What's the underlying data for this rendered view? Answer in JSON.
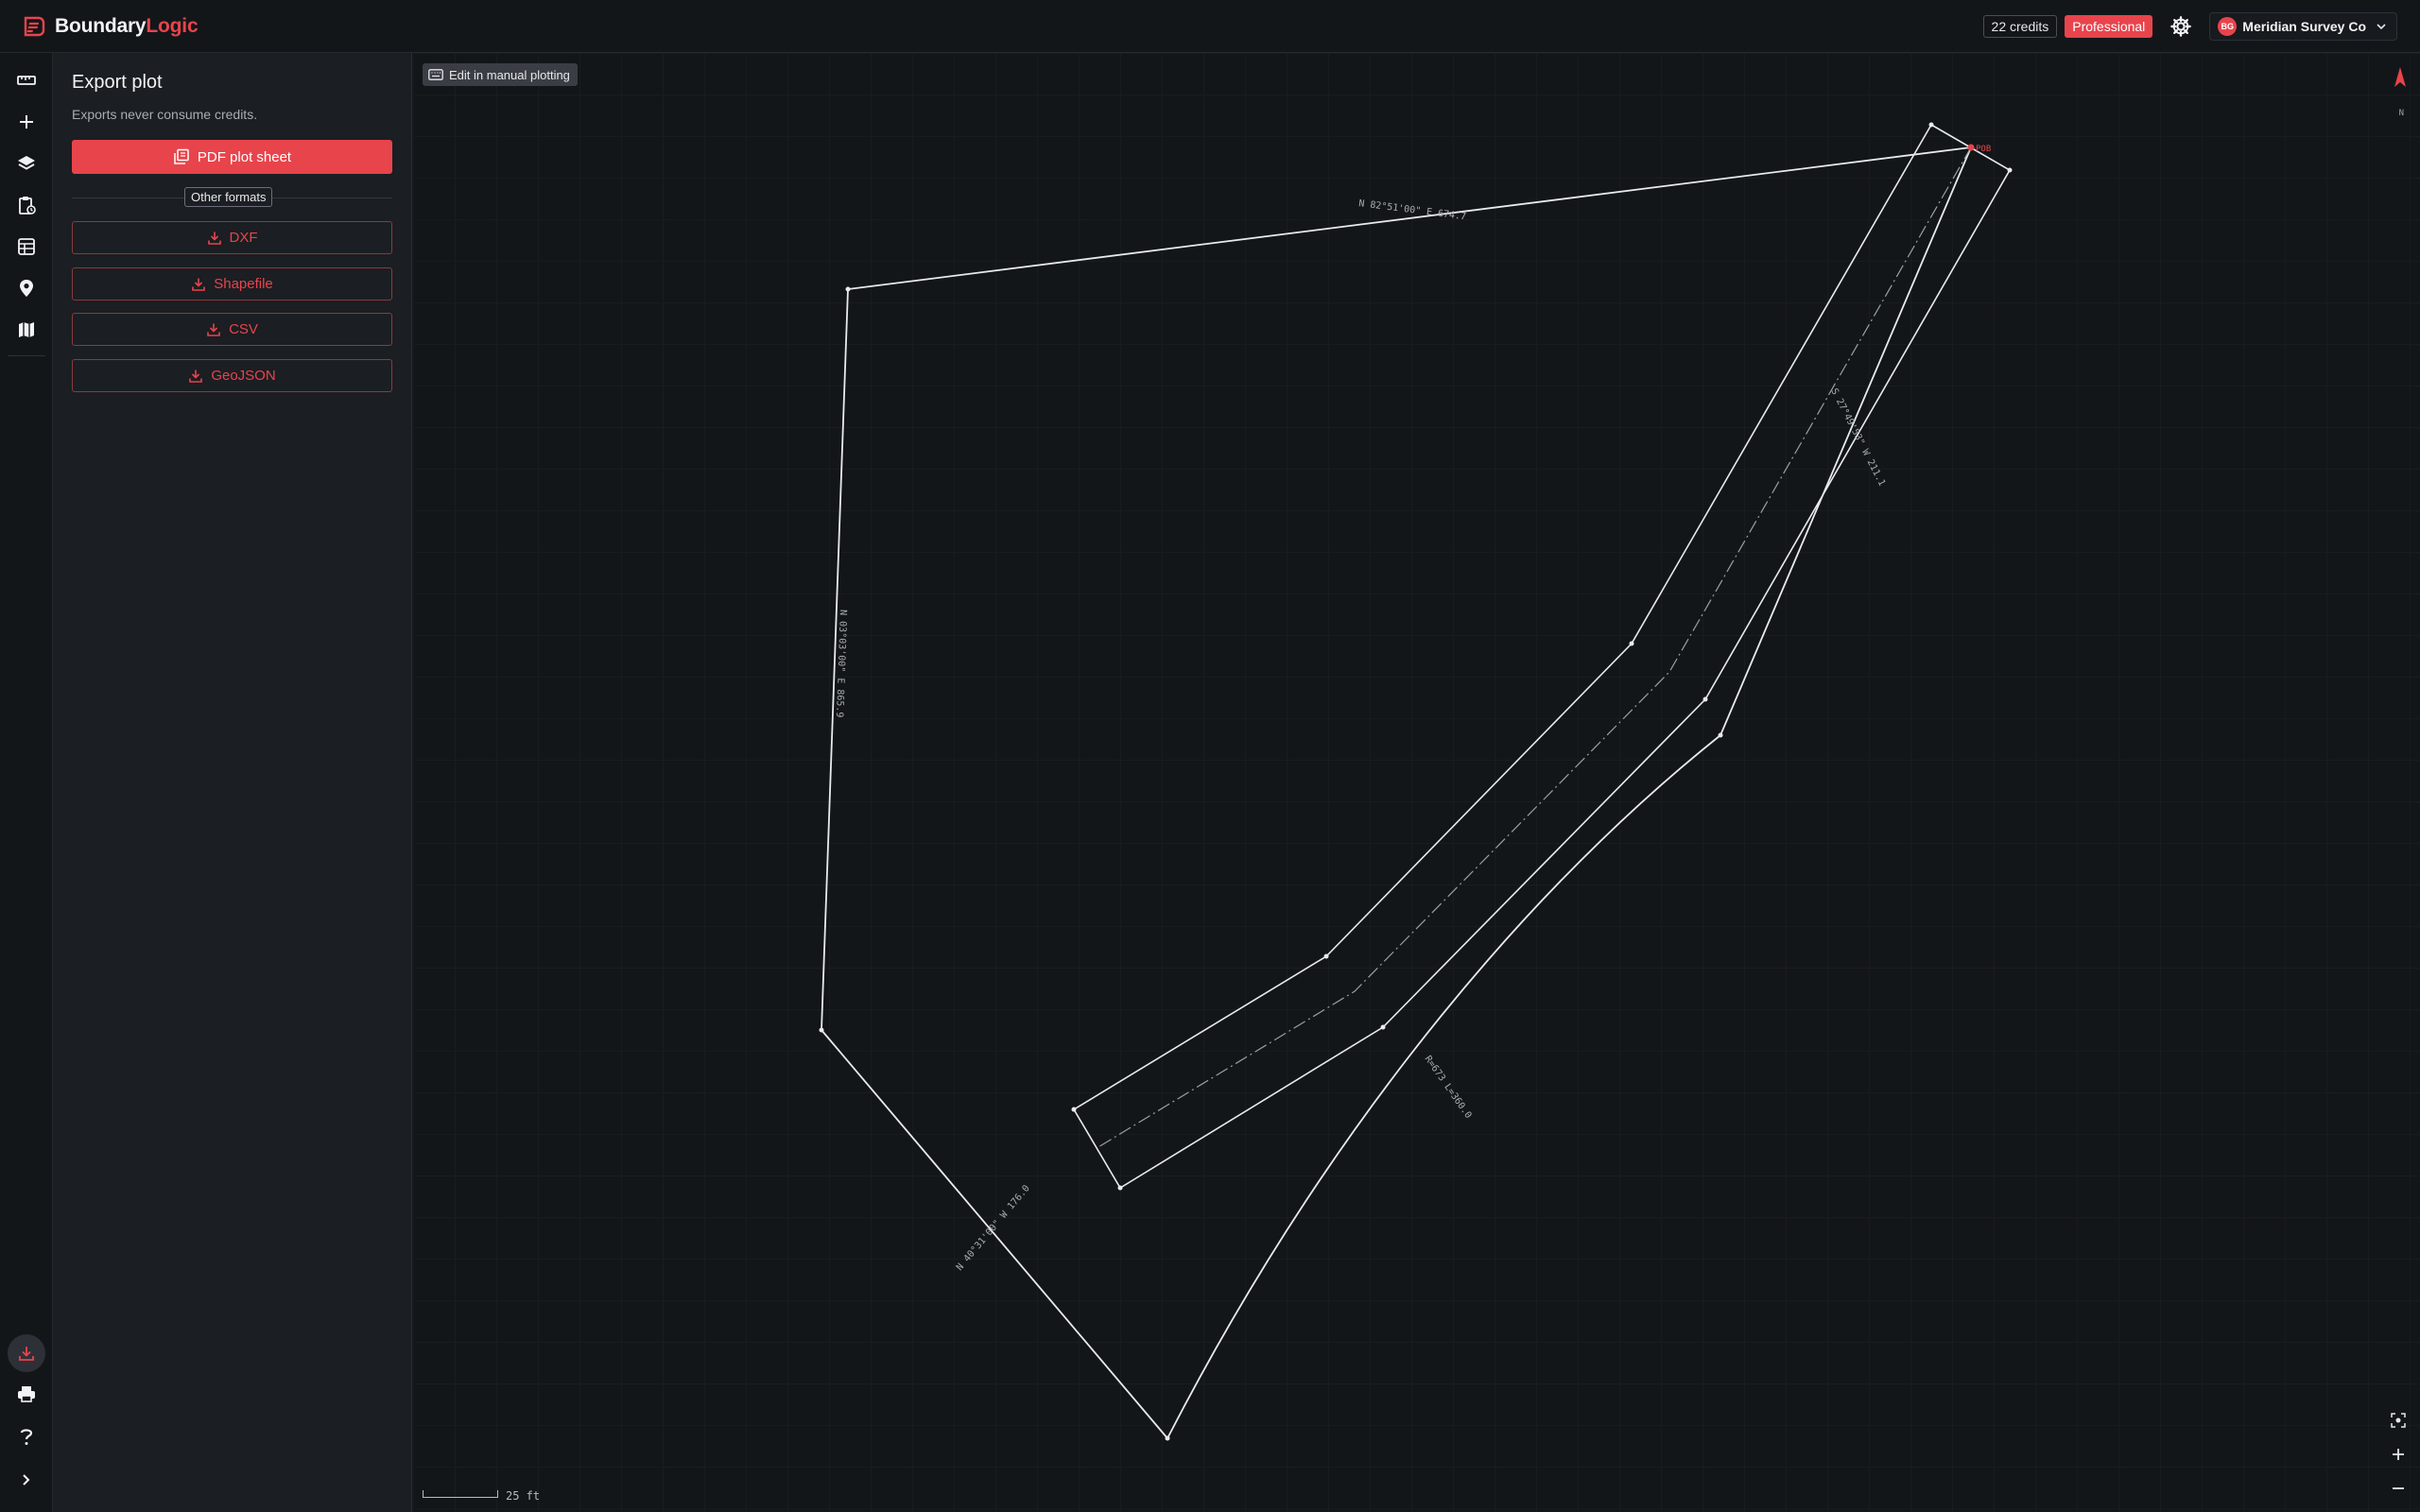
{
  "app": {
    "name_part1": "Boundary",
    "name_part2": "Logic"
  },
  "header": {
    "credits": "22 credits",
    "plan": "Professional",
    "account_initials": "BG",
    "account_name": "Meridian Survey Co"
  },
  "rail": {
    "items": [
      "ruler-icon",
      "plus-icon",
      "layers-icon",
      "clipboard-icon",
      "table-icon",
      "location-pin-icon",
      "map-icon"
    ],
    "bottom": [
      "download-icon",
      "printer-icon",
      "help-icon",
      "expand-icon"
    ]
  },
  "panel": {
    "title": "Export plot",
    "subtitle": "Exports never consume credits.",
    "primary_label": "PDF plot sheet",
    "other_formats_label": "Other formats",
    "formats": [
      "DXF",
      "Shapefile",
      "CSV",
      "GeoJSON"
    ]
  },
  "map": {
    "edit_chip": "Edit in manual plotting",
    "north_label": "N",
    "scale_label": "25 ft",
    "pob_label": "POB",
    "bearing_labels": [
      "N 82°51'00\" E 674.7",
      "N 03°03'00\" E 865.9",
      "N 40°31'00\" W 176.0",
      "R=673 L=360.0",
      "S 27°49'53\" W 211.1"
    ]
  },
  "colors": {
    "accent": "#e8444c",
    "background": "#131619",
    "panel": "#1b1e22",
    "line": "#e8eaec"
  }
}
